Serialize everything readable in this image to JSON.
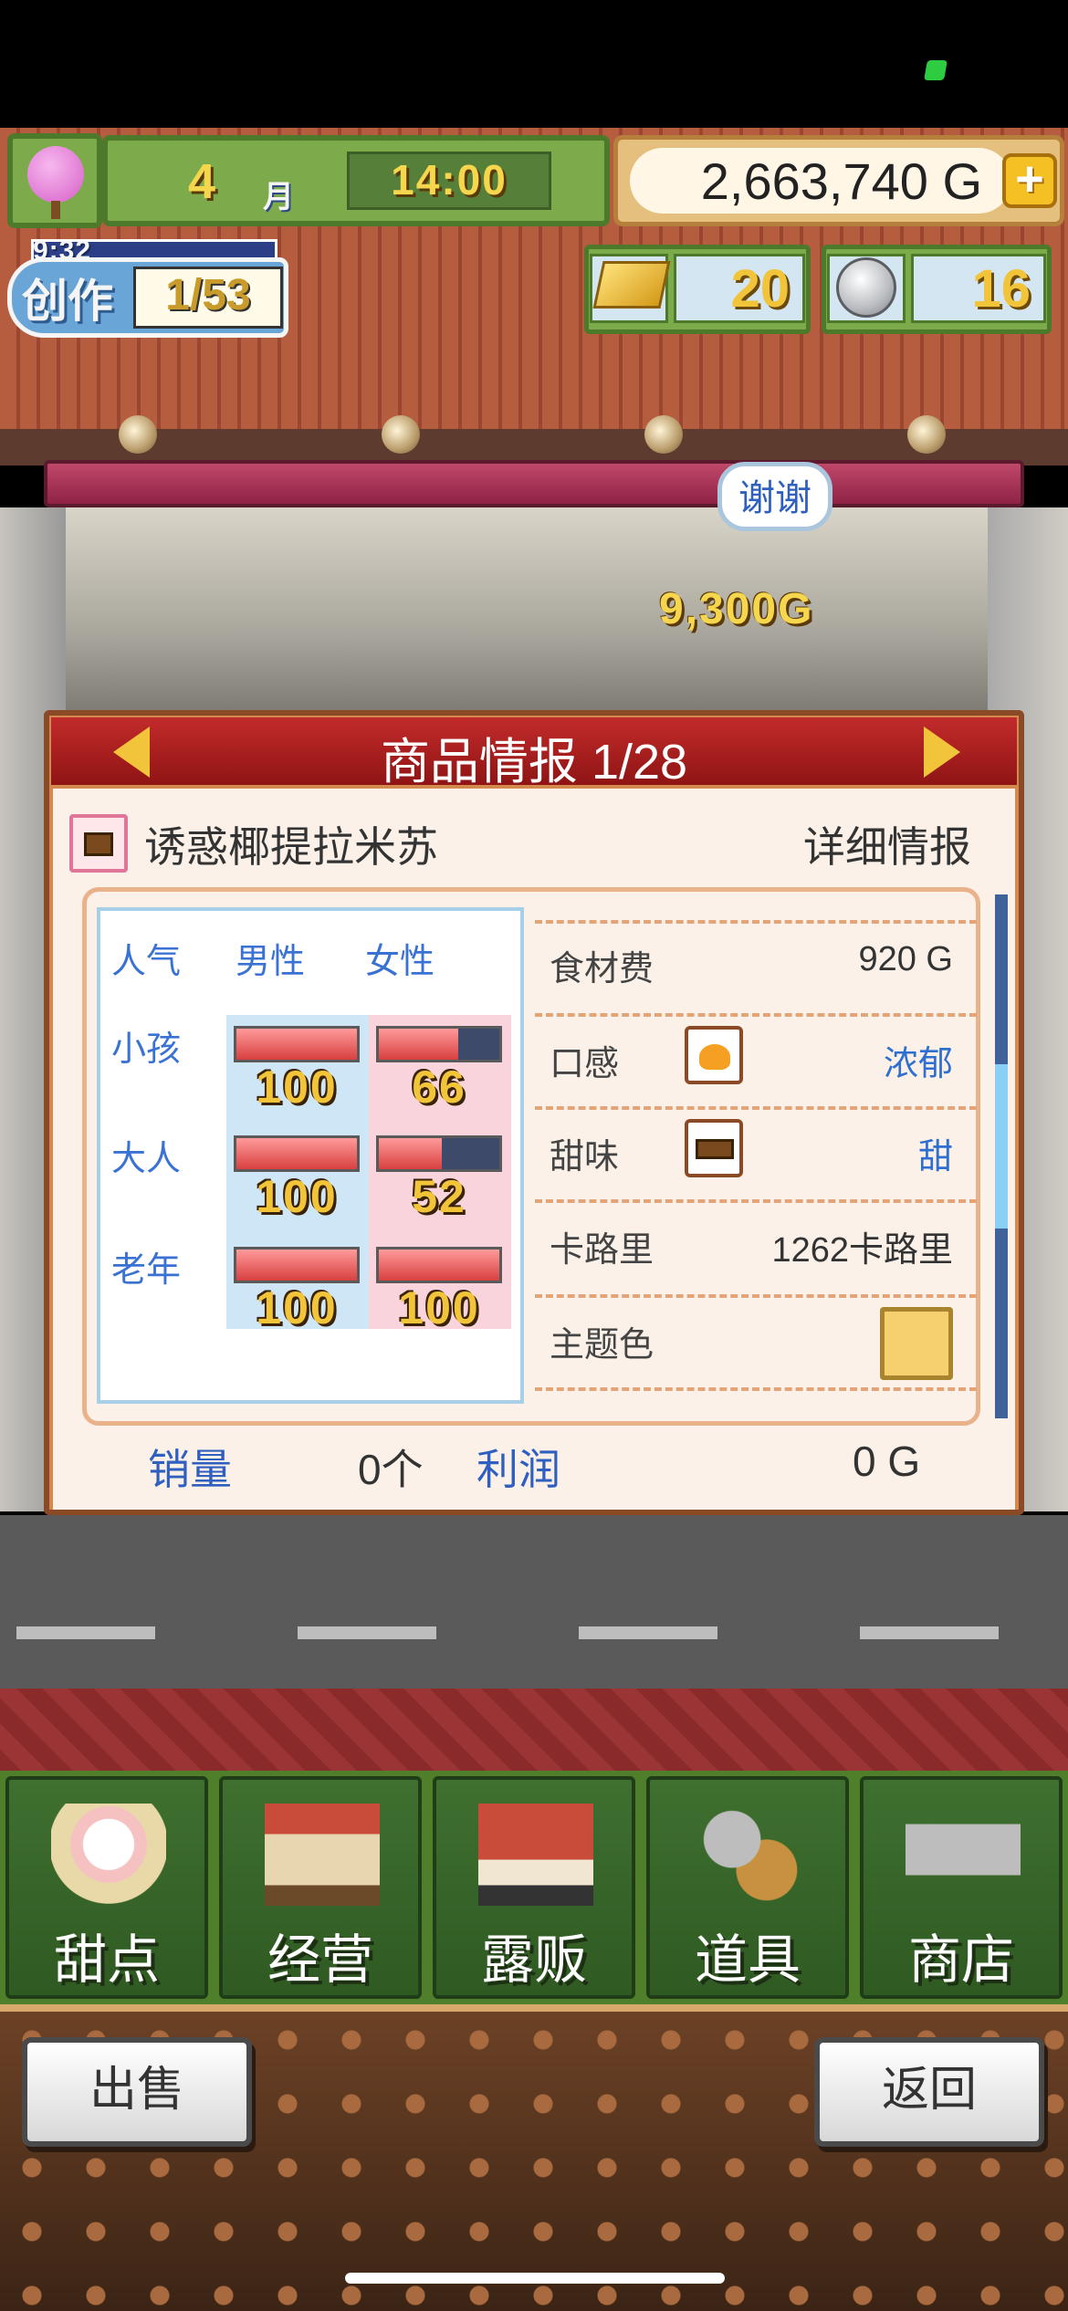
{
  "hud": {
    "month_number": "4",
    "month_unit": "月",
    "time": "14:00",
    "money": "2,663,740 G",
    "plus_symbol": "+",
    "create_timer": "9:32",
    "create_label": "创作",
    "create_count": "1/53",
    "gold_count": "20",
    "medal_count": "16"
  },
  "scene": {
    "thanks_bubble": "谢谢",
    "floating_money": "9,300G"
  },
  "dialog": {
    "title": "商品情报 1/28",
    "product_name": "诱惑椰提拉米苏",
    "detail_link": "详细情报",
    "popularity": {
      "header_label": "人气",
      "male_label": "男性",
      "female_label": "女性",
      "rows": [
        {
          "label": "小孩",
          "male": 100,
          "female": 66
        },
        {
          "label": "大人",
          "male": 100,
          "female": 52
        },
        {
          "label": "老年",
          "male": 100,
          "female": 100
        }
      ]
    },
    "stats": {
      "ingredient_cost_label": "食材费",
      "ingredient_cost_value": "920 G",
      "texture_label": "口感",
      "texture_value": "浓郁",
      "sweetness_label": "甜味",
      "sweetness_value": "甜",
      "calories_label": "卡路里",
      "calories_value": "1262卡路里",
      "theme_color_label": "主题色",
      "theme_color": "#F6CF6E"
    },
    "footer": {
      "sales_label": "销量",
      "sales_value": "0个",
      "profit_label": "利润",
      "profit_value": "0 G"
    }
  },
  "menu": {
    "items": [
      {
        "label": "甜点",
        "icon": "cake-icon"
      },
      {
        "label": "经营",
        "icon": "shop-icon"
      },
      {
        "label": "露贩",
        "icon": "food-truck-icon"
      },
      {
        "label": "道具",
        "icon": "gear-bag-icon"
      },
      {
        "label": "商店",
        "icon": "cart-icon"
      }
    ]
  },
  "actions": {
    "sell_label": "出售",
    "back_label": "返回"
  },
  "colors": {
    "header_red": "#B01F1F",
    "popularity_blue": "#3A72D4",
    "meter_red": "#D84040",
    "menu_green": "#3F7030"
  }
}
